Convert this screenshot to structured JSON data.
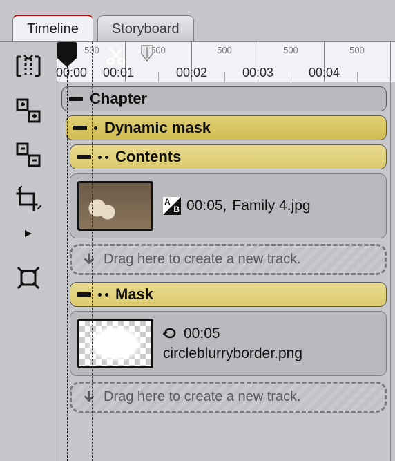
{
  "tabs": {
    "timeline": "Timeline",
    "storyboard": "Storyboard",
    "active": "timeline"
  },
  "ruler": {
    "majors": [
      "00:00",
      "00:01",
      "00:02",
      "00:03",
      "00:04"
    ],
    "minor_label": "500"
  },
  "tracks": {
    "chapter_label": "Chapter",
    "dynamic_mask_label": "Dynamic mask",
    "contents_label": "Contents",
    "mask_label": "Mask",
    "dropzone_text": "Drag here to create a new track."
  },
  "clips": {
    "family": {
      "duration": "00:05,",
      "filename": "Family 4.jpg"
    },
    "mask": {
      "duration": "00:05",
      "filename": "circleblurryborder.png"
    }
  },
  "sidebar_tools": [
    "split-track",
    "zoom-in-all",
    "zoom-out-all",
    "crop",
    "play",
    "fit"
  ]
}
